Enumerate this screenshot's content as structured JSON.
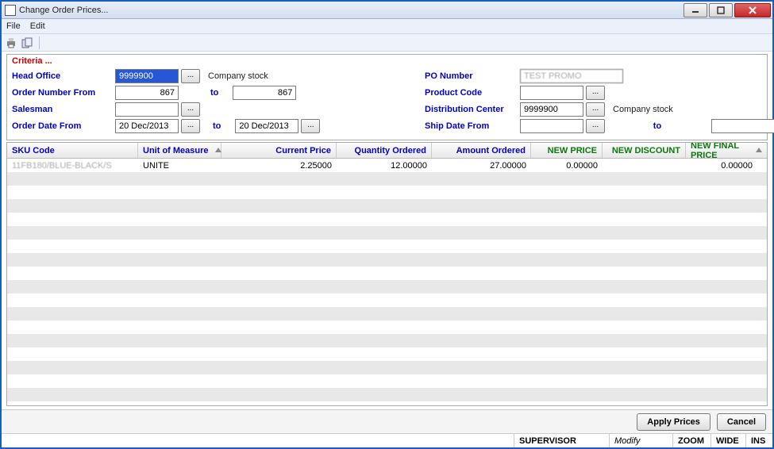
{
  "window": {
    "title": "Change Order Prices..."
  },
  "menu": {
    "file": "File",
    "edit": "Edit"
  },
  "criteria": {
    "title": "Criteria ...",
    "labels": {
      "head_office": "Head Office",
      "order_number_from": "Order Number From",
      "to": "to",
      "salesman": "Salesman",
      "order_date_from": "Order Date From",
      "po_number": "PO Number",
      "product_code": "Product Code",
      "dist_center": "Distribution Center",
      "ship_date_from": "Ship Date From",
      "company_stock": "Company stock"
    },
    "values": {
      "head_office": "9999900",
      "order_number_from": "867",
      "order_number_to": "867",
      "salesman": "",
      "order_date_from": "20 Dec/2013",
      "order_date_to": "20 Dec/2013",
      "po_number": "TEST PROMO",
      "product_code": "",
      "dist_center": "9999900",
      "ship_date_from": "",
      "ship_date_to": ""
    },
    "ellipsis": "..."
  },
  "grid": {
    "headers": {
      "sku": "SKU Code",
      "uom": "Unit of Measure",
      "current_price": "Current Price",
      "qty_ordered": "Quantity Ordered",
      "amt_ordered": "Amount Ordered",
      "new_price": "NEW PRICE",
      "new_discount": "NEW DISCOUNT",
      "new_final_price": "NEW FINAL PRICE"
    },
    "rows": [
      {
        "sku": "11FB180/BLUE-BLACK/S",
        "uom": "UNITE",
        "current_price": "2.25000",
        "qty_ordered": "12.00000",
        "amt_ordered": "27.00000",
        "new_price": "0.00000",
        "new_discount": "",
        "new_final_price": "0.00000"
      }
    ]
  },
  "buttons": {
    "apply": "Apply Prices",
    "cancel": "Cancel"
  },
  "status": {
    "user": "SUPERVISOR",
    "mode": "Modify",
    "zoom": "ZOOM",
    "wide": "WIDE",
    "ins": "INS"
  }
}
